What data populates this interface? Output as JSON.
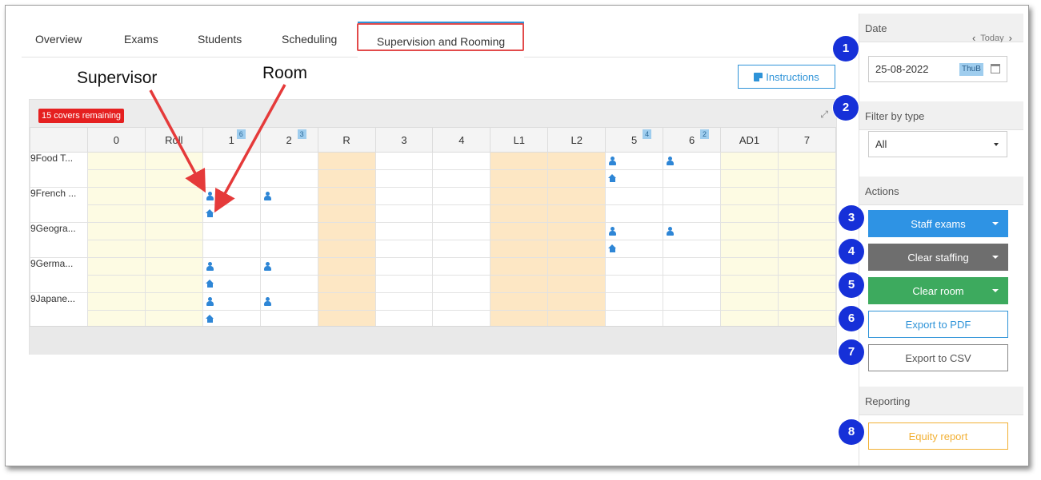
{
  "tabs": [
    "Overview",
    "Exams",
    "Students",
    "Scheduling"
  ],
  "active_tab": "Supervision and Rooming",
  "annotations": {
    "supervisor": "Supervisor",
    "room": "Room"
  },
  "instructions_label": "Instructions",
  "covers_remaining": "15 covers remaining",
  "grid": {
    "columns": [
      "0",
      "Roll",
      "1",
      "2",
      "R",
      "3",
      "4",
      "L1",
      "L2",
      "5",
      "6",
      "AD1",
      "7"
    ],
    "column_badges": {
      "1": "6",
      "2": "3",
      "5": "4",
      "6": "2"
    },
    "rows": [
      "9Food T...",
      "9French ...",
      "9Geogra...",
      "9Germa...",
      "9Japane..."
    ]
  },
  "sidebar": {
    "date_title": "Date",
    "today_label": "Today",
    "date_value": "25-08-2022",
    "week_badge": "ThuB",
    "filter_title": "Filter by type",
    "filter_value": "All",
    "actions_title": "Actions",
    "staff_exams": "Staff exams",
    "clear_staffing": "Clear staffing",
    "clear_room": "Clear room",
    "export_pdf": "Export to PDF",
    "export_csv": "Export to CSV",
    "reporting_title": "Reporting",
    "equity_report": "Equity report"
  },
  "callouts": [
    "1",
    "2",
    "3",
    "4",
    "5",
    "6",
    "7",
    "8"
  ],
  "colors": {
    "accent": "#2e93d8",
    "staff_exams": "#2e93e4",
    "clear_staffing": "#6e6e6e",
    "clear_room": "#3daa5e",
    "equity": "#f2b034",
    "callout": "#1630d8",
    "covers": "#e52020"
  },
  "icons": {
    "supervisor": "person-icon",
    "room": "home-icon",
    "calendar": "calendar-icon",
    "instructions": "note-icon"
  }
}
